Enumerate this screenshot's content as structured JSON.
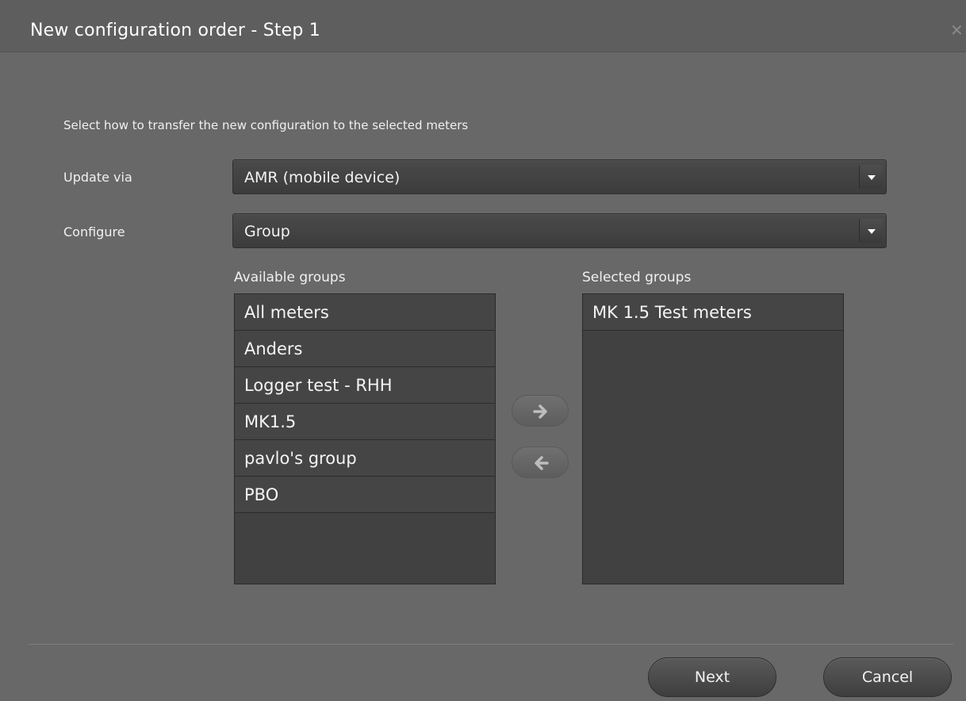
{
  "dialog": {
    "title": "New configuration order - Step 1",
    "close_icon": "close-icon"
  },
  "instruction": "Select how to transfer the new configuration to the selected meters",
  "update_via": {
    "label": "Update via",
    "value": "AMR (mobile device)"
  },
  "configure": {
    "label": "Configure",
    "value": "Group"
  },
  "available_groups": {
    "label": "Available groups",
    "items": [
      "All meters",
      "Anders",
      "Logger test - RHH",
      "MK1.5",
      "pavlo's group",
      "PBO"
    ]
  },
  "selected_groups": {
    "label": "Selected groups",
    "items": [
      "MK 1.5 Test meters"
    ]
  },
  "transfer": {
    "add_icon": "arrow-right-icon",
    "remove_icon": "arrow-left-icon"
  },
  "footer": {
    "next_label": "Next",
    "cancel_label": "Cancel"
  }
}
